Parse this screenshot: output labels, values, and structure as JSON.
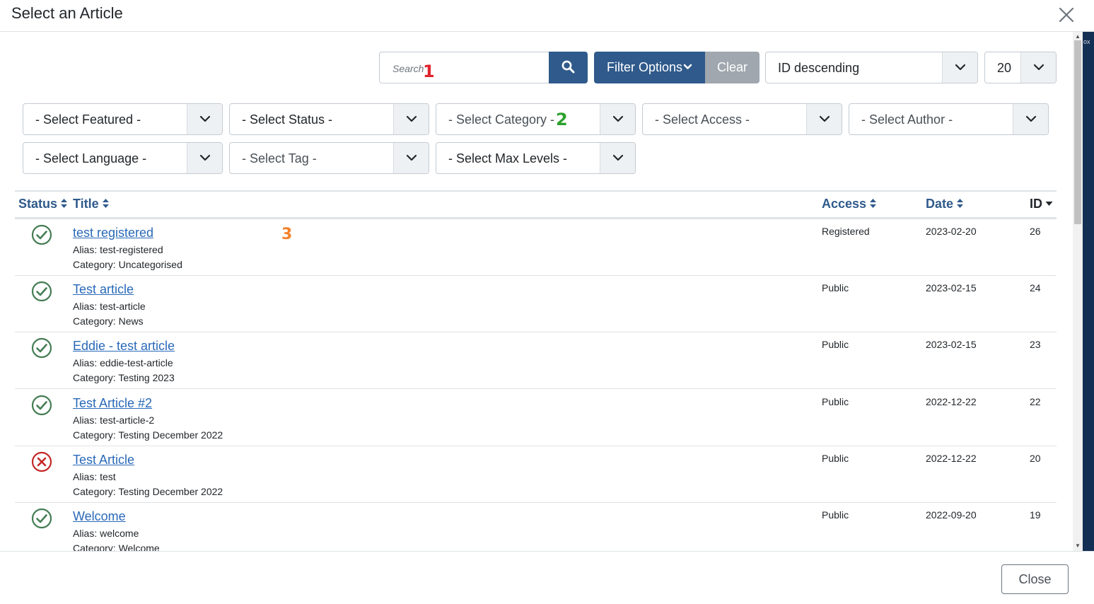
{
  "modal": {
    "title": "Select an Article",
    "close_label": "Close"
  },
  "page_strip_text": "ox",
  "toolbar": {
    "search_placeholder": "Search",
    "filter_options_label": "Filter Options",
    "clear_label": "Clear",
    "ordering_value": "ID descending",
    "limit_value": "20"
  },
  "filters": {
    "featured": "- Select Featured -",
    "status": "- Select Status -",
    "category": "- Select Category -",
    "access": "- Select Access -",
    "author": "- Select Author -",
    "language": "- Select Language -",
    "tag": "- Select Tag -",
    "max_levels": "- Select Max Levels -"
  },
  "annotations": {
    "a1": "1",
    "a2": "2",
    "a3": "3"
  },
  "table": {
    "headers": {
      "status": "Status",
      "title": "Title",
      "access": "Access",
      "date": "Date",
      "id": "ID"
    },
    "rows": [
      {
        "status": "published",
        "title": "test registered",
        "alias": "Alias: test-registered",
        "category": "Category: Uncategorised",
        "access": "Registered",
        "date": "2023-02-20",
        "id": "26"
      },
      {
        "status": "published",
        "title": "Test article",
        "alias": "Alias: test-article",
        "category": "Category: News",
        "access": "Public",
        "date": "2023-02-15",
        "id": "24"
      },
      {
        "status": "published",
        "title": "Eddie - test article",
        "alias": "Alias: eddie-test-article",
        "category": "Category: Testing 2023",
        "access": "Public",
        "date": "2023-02-15",
        "id": "23"
      },
      {
        "status": "published",
        "title": "Test Article #2",
        "alias": "Alias: test-article-2",
        "category": "Category: Testing December 2022",
        "access": "Public",
        "date": "2022-12-22",
        "id": "22"
      },
      {
        "status": "unpublished",
        "title": "Test Article",
        "alias": "Alias: test",
        "category": "Category: Testing December 2022",
        "access": "Public",
        "date": "2022-12-22",
        "id": "20"
      },
      {
        "status": "published",
        "title": "Welcome",
        "alias": "Alias: welcome",
        "category": "Category: Welcome",
        "access": "Public",
        "date": "2022-09-20",
        "id": "19"
      }
    ]
  },
  "colors": {
    "primary": "#2f5a8b",
    "link": "#2a69b8",
    "published": "#457d54",
    "unpublished": "#c52827",
    "annotation_1": "#e0242e",
    "annotation_2": "#2ca02c",
    "annotation_3": "#f4822a"
  }
}
